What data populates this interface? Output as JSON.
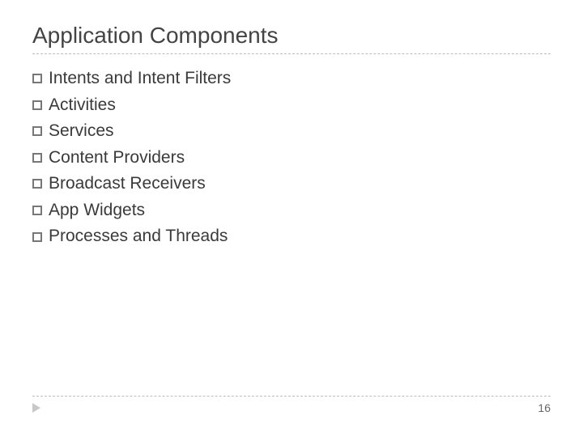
{
  "title": "Application Components",
  "items": [
    "Intents and Intent Filters",
    "Activities",
    "Services",
    "Content Providers",
    "Broadcast Receivers",
    "App Widgets",
    "Processes and Threads"
  ],
  "page_number": "16"
}
